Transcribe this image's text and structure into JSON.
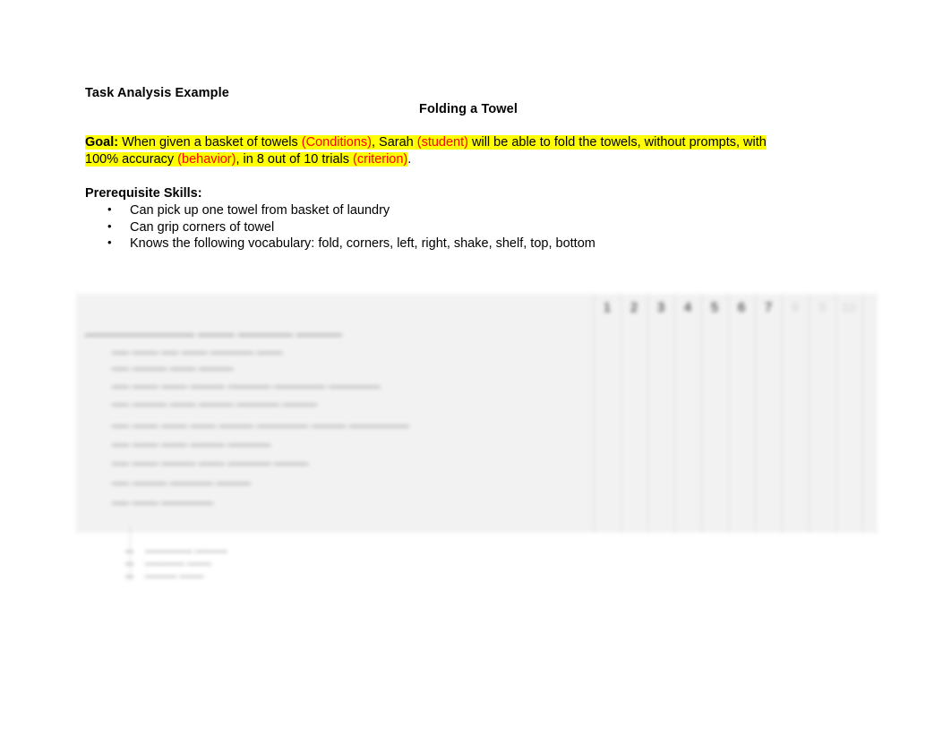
{
  "document": {
    "title": "Task Analysis Example",
    "subtitle": "Folding a Towel"
  },
  "goal": {
    "label": "Goal:",
    "line1": {
      "seg1": "  When given a basket of towels ",
      "tag1": "(Conditions)",
      "seg2": ", Sarah ",
      "tag2": "(student)",
      "seg3": " will be able to fold the towels, without prompts, with"
    },
    "line2": {
      "seg1": "100% accuracy ",
      "tag1": "(behavior)",
      "seg2": ", in 8 out of 10 trials ",
      "tag2": "(criterion)",
      "seg3": "."
    },
    "highlight_color": "#ffff00",
    "tag_color": "#ff0000"
  },
  "prerequisites": {
    "heading": "Prerequisite Skills:",
    "items": [
      "Can pick up one towel from basket of laundry",
      "Can grip corners of towel",
      "Knows the following vocabulary:  fold, corners, left, right, shake, shelf, top, bottom"
    ]
  },
  "trial_table": {
    "column_headers": [
      "1",
      "2",
      "3",
      "4",
      "5",
      "6",
      "7",
      "8",
      "9",
      "10"
    ],
    "legible_headers": [
      "1",
      "2",
      "3",
      "4",
      "5",
      "6",
      "7"
    ],
    "faint_headers": [
      "8",
      "9",
      "10"
    ],
    "steps_column_header": "",
    "rows": [
      {
        "step": "",
        "detail": ""
      },
      {
        "step": "",
        "detail": ""
      },
      {
        "step": "",
        "detail": ""
      },
      {
        "step": "",
        "detail": ""
      },
      {
        "step": "",
        "detail": ""
      },
      {
        "step": "",
        "detail": ""
      },
      {
        "step": "",
        "detail": ""
      },
      {
        "step": "",
        "detail": ""
      },
      {
        "step": "",
        "detail": ""
      },
      {
        "step": "",
        "detail": ""
      }
    ],
    "note": "table body text is out of focus and not legible"
  },
  "legend": {
    "rows": [
      "",
      "",
      ""
    ],
    "note": "legend text is out of focus and not legible"
  }
}
